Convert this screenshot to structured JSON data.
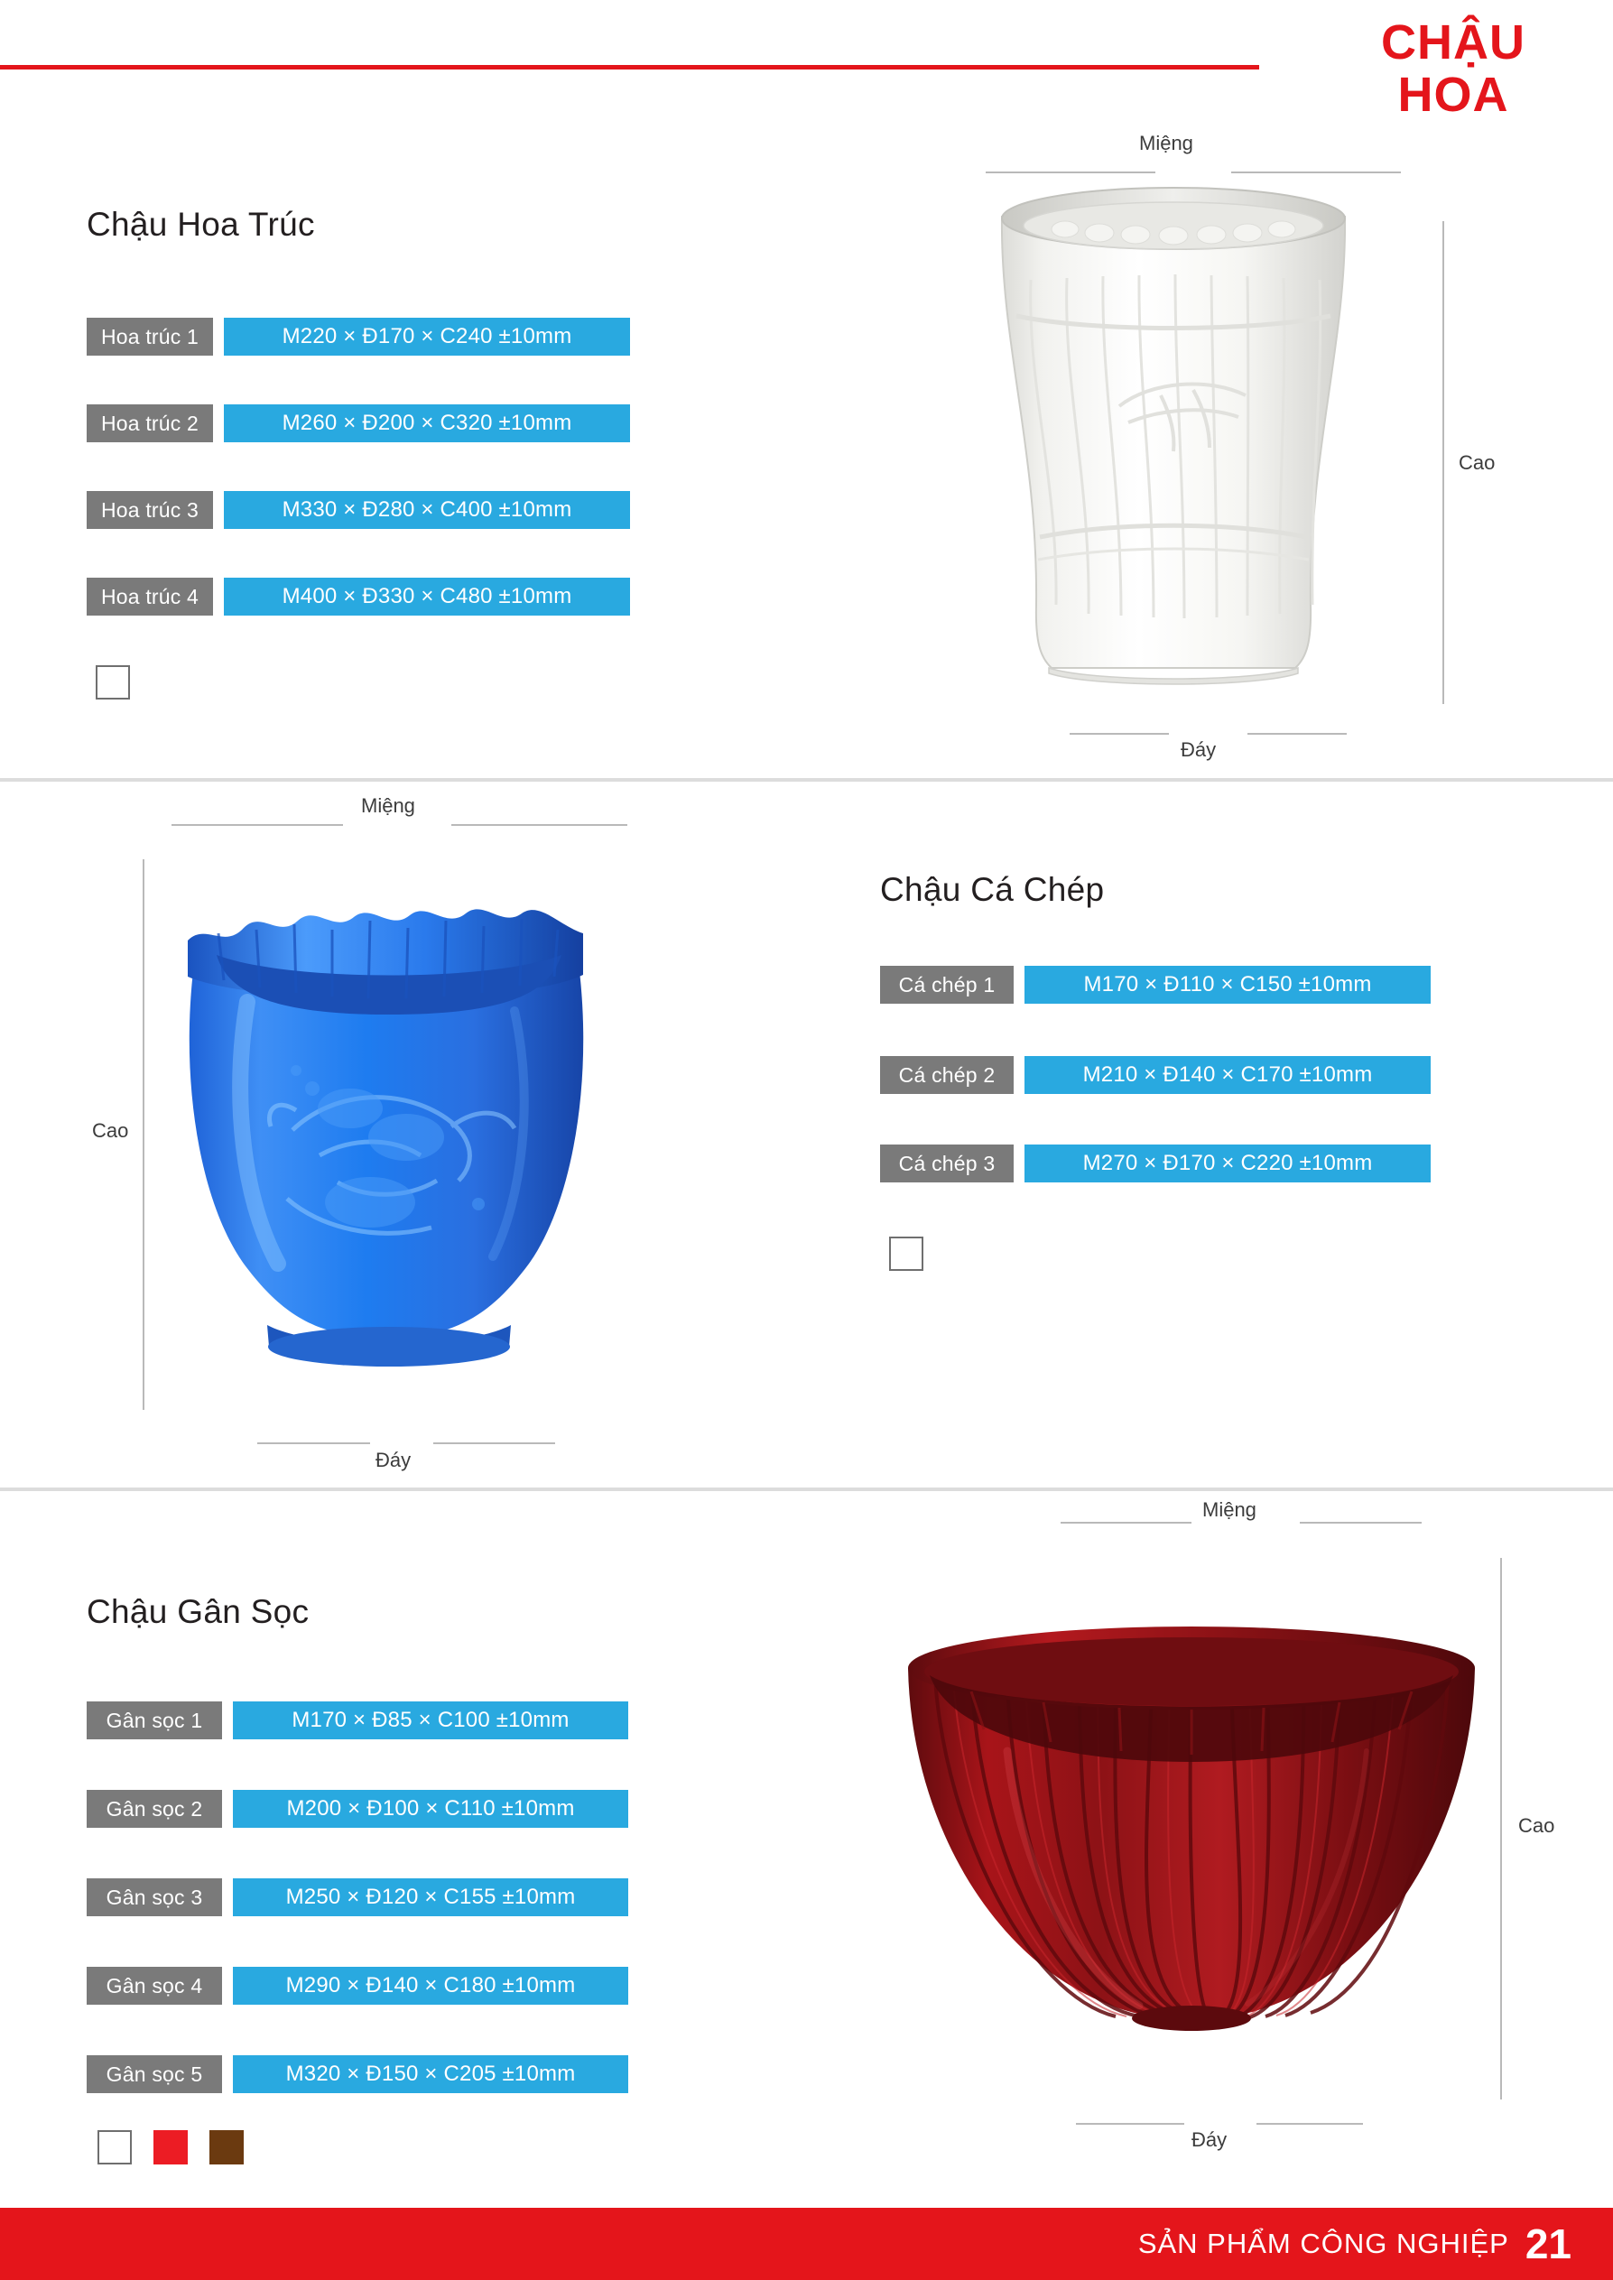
{
  "header": {
    "title_line1": "CHẬU",
    "title_line2": "HOA",
    "accent_color": "#e4151b"
  },
  "sections": [
    {
      "id": "hoa-truc",
      "title": "Chậu Hoa Trúc",
      "specs": [
        {
          "name": "Hoa trúc 1",
          "value": "M220 × Đ170 × C240 ±10mm"
        },
        {
          "name": "Hoa trúc 2",
          "value": "M260 × Đ200 × C320 ±10mm"
        },
        {
          "name": "Hoa trúc 3",
          "value": "M330 × Đ280 × C400 ±10mm"
        },
        {
          "name": "Hoa trúc 4",
          "value": "M400 × Đ330 × C480 ±10mm"
        }
      ],
      "colors": [
        {
          "name": "white",
          "hex": "#ffffff"
        }
      ],
      "guides": {
        "top": "Miệng",
        "bottom": "Đáy",
        "side": "Cao"
      }
    },
    {
      "id": "ca-chep",
      "title": "Chậu Cá Chép",
      "specs": [
        {
          "name": "Cá chép 1",
          "value": "M170 × Đ110 × C150 ±10mm"
        },
        {
          "name": "Cá chép 2",
          "value": "M210 × Đ140 × C170 ±10mm"
        },
        {
          "name": "Cá chép 3",
          "value": "M270 × Đ170 × C220 ±10mm"
        }
      ],
      "colors": [
        {
          "name": "white",
          "hex": "#ffffff"
        }
      ],
      "guides": {
        "top": "Miệng",
        "bottom": "Đáy",
        "side": "Cao"
      }
    },
    {
      "id": "gan-soc",
      "title": "Chậu Gân Sọc",
      "specs": [
        {
          "name": "Gân sọc 1",
          "value": "M170 × Đ85 × C100 ±10mm"
        },
        {
          "name": "Gân sọc 2",
          "value": "M200 × Đ100 × C110 ±10mm"
        },
        {
          "name": "Gân sọc 3",
          "value": "M250 × Đ120 × C155 ±10mm"
        },
        {
          "name": "Gân sọc 4",
          "value": "M290 × Đ140 × C180 ±10mm"
        },
        {
          "name": "Gân sọc 5",
          "value": "M320 × Đ150 × C205 ±10mm"
        }
      ],
      "colors": [
        {
          "name": "white",
          "hex": "#ffffff"
        },
        {
          "name": "red",
          "hex": "#ec1c24"
        },
        {
          "name": "brown",
          "hex": "#6b3a10"
        }
      ],
      "guides": {
        "top": "Miệng",
        "bottom": "Đáy",
        "side": "Cao"
      }
    }
  ],
  "footer": {
    "text": "SẢN PHẨM CÔNG NGHIỆP",
    "page": "21",
    "background": "#e4151b"
  },
  "styles": {
    "label_bg": "#7a7a7a",
    "value_bg": "#29a9e0"
  }
}
